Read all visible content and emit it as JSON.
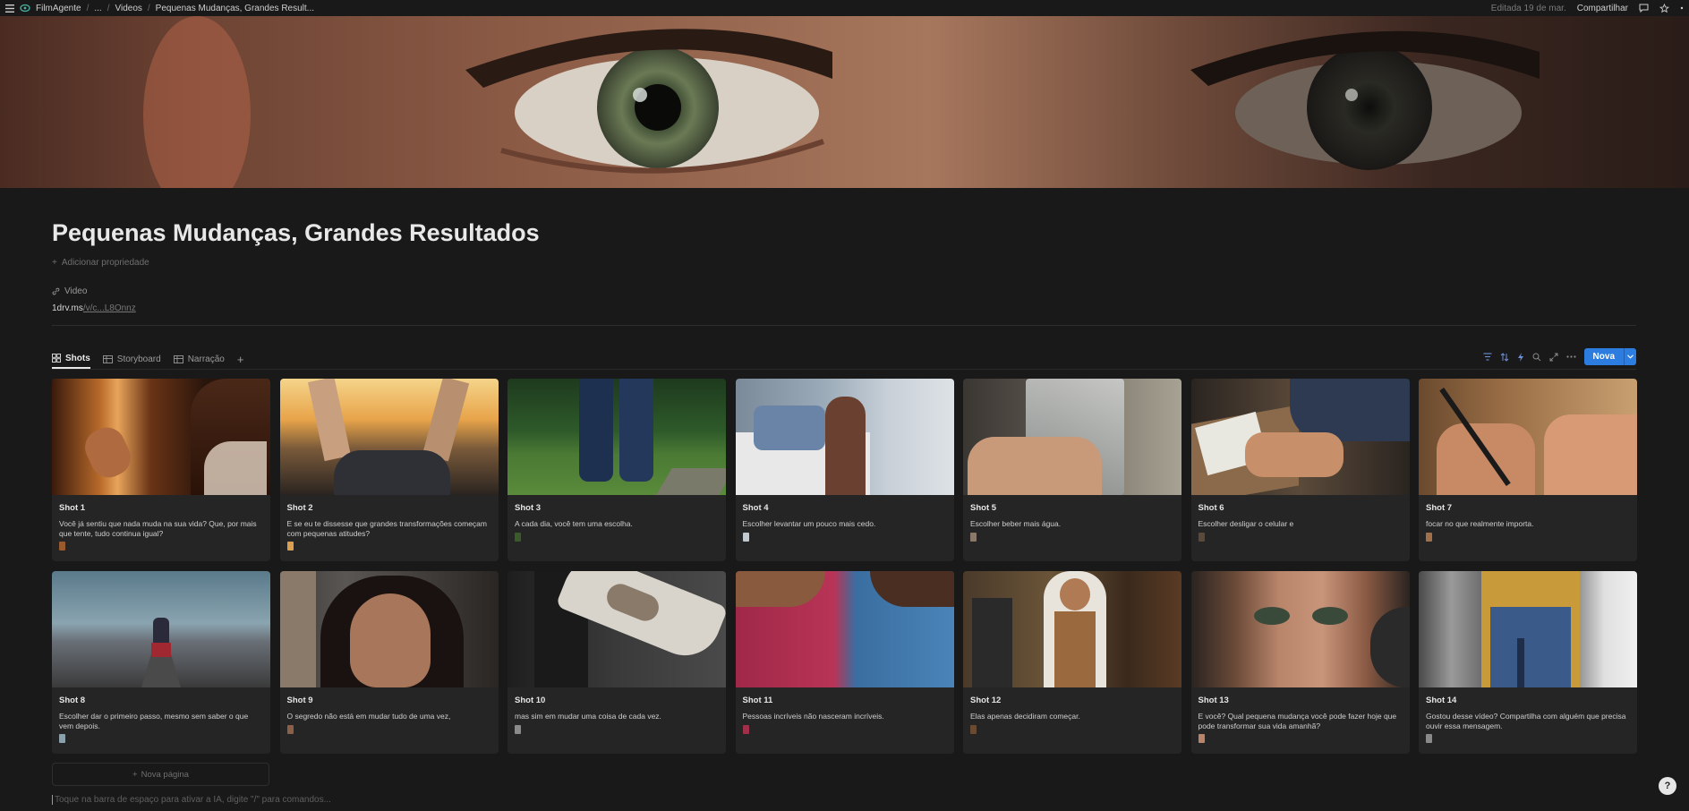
{
  "topbar": {
    "workspace": "FilmAgente",
    "ellipsis": "...",
    "crumb1": "Videos",
    "crumb2": "Pequenas Mudanças, Grandes Result...",
    "edited": "Editada 19 de mar.",
    "share": "Compartilhar"
  },
  "page": {
    "title": "Pequenas Mudanças, Grandes Resultados",
    "add_property": "Adicionar propriedade",
    "prop_label": "Video",
    "prop_value_main": "1drv.ms",
    "prop_value_rest": "/v/c...L8Onnz"
  },
  "tabs": [
    {
      "label": "Shots"
    },
    {
      "label": "Storyboard"
    },
    {
      "label": "Narração"
    }
  ],
  "new_button": "Nova",
  "shots": [
    {
      "name": "Shot 1",
      "text": "Você já sentiu que nada muda na sua vida? Que, por mais que tente, tudo continua igual?"
    },
    {
      "name": "Shot 2",
      "text": "E se eu te dissesse que grandes transformações começam com pequenas atitudes?"
    },
    {
      "name": "Shot 3",
      "text": "A cada dia, você tem uma escolha."
    },
    {
      "name": "Shot 4",
      "text": "Escolher levantar um pouco mais cedo."
    },
    {
      "name": "Shot 5",
      "text": "Escolher beber mais água."
    },
    {
      "name": "Shot 6",
      "text": "Escolher desligar o celular e"
    },
    {
      "name": "Shot 7",
      "text": "focar no que realmente importa."
    },
    {
      "name": "Shot 8",
      "text": "Escolher dar o primeiro passo, mesmo sem saber o que vem depois."
    },
    {
      "name": "Shot 9",
      "text": "O segredo não está em mudar tudo de uma vez,"
    },
    {
      "name": "Shot 10",
      "text": "mas sim em mudar uma coisa de cada vez."
    },
    {
      "name": "Shot 11",
      "text": "Pessoas incríveis não nasceram incríveis."
    },
    {
      "name": "Shot 12",
      "text": "Elas apenas decidiram começar."
    },
    {
      "name": "Shot 13",
      "text": "E você? Qual pequena mudança você pode fazer hoje que pode transformar sua vida amanhã?"
    },
    {
      "name": "Shot 14",
      "text": "Gostou desse vídeo? Compartilha com alguém que precisa ouvir essa mensagem."
    }
  ],
  "new_page": "Nova página",
  "hint": "Toque na barra de espaço para ativar a IA, digite \"/\" para comandos...",
  "colors": {
    "accent": "#2d7de0",
    "background": "#191919",
    "card": "#252525"
  }
}
